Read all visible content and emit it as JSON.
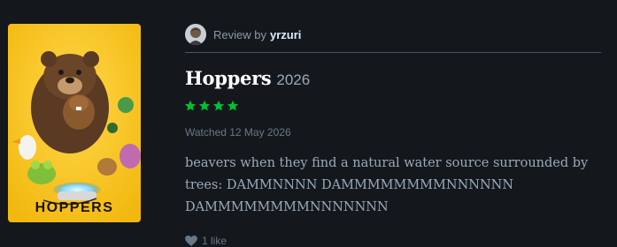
{
  "poster": {
    "title_text": "HOPPERS"
  },
  "review": {
    "prefix": "Review by",
    "username": "yrzuri",
    "film_title": "Hoppers",
    "film_year": "2026",
    "rating_stars": 4,
    "watched": "Watched 12 May 2026",
    "body": "beavers when they find a natural water source surrounded by trees: DAMMNNNN DAMMMMMMMMNNNNNN DAMMMMMMMMNNNNNNN",
    "likes": "1 like"
  },
  "colors": {
    "background": "#14181c",
    "star": "#00c030",
    "poster_background": "#f4c21b"
  },
  "icons": [
    "avatar",
    "star-icon",
    "heart-icon"
  ]
}
